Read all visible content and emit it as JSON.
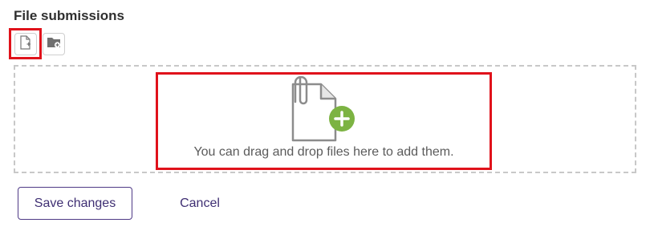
{
  "section": {
    "title": "File submissions"
  },
  "toolbar": {
    "buttons": [
      {
        "icon": "add-file-icon"
      },
      {
        "icon": "create-folder-icon"
      }
    ]
  },
  "dropzone": {
    "icon": "file-add-icon",
    "message": "You can drag and drop files here to add them."
  },
  "actions": {
    "save_label": "Save changes",
    "cancel_label": "Cancel"
  },
  "colors": {
    "highlight": "#e0121b",
    "accent": "#4f3a86",
    "plus_badge": "#7cb342"
  }
}
